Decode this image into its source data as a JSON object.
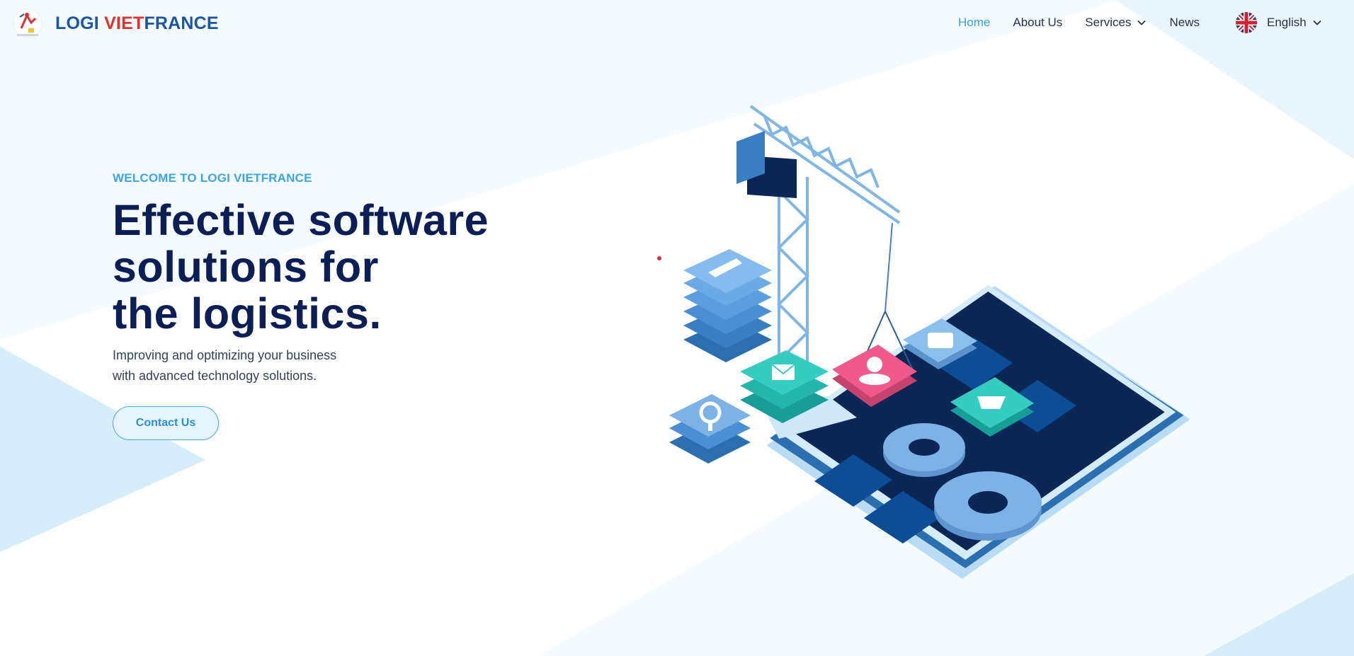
{
  "brand": {
    "name_part1": "LOGI ",
    "name_part2": "VIET",
    "name_part3": "FRANCE",
    "logo_icon": "logi-vietfrance-emblem"
  },
  "nav": {
    "items": [
      {
        "label": "Home",
        "active": true
      },
      {
        "label": "About Us",
        "active": false
      },
      {
        "label": "Services",
        "active": false,
        "has_dropdown": true
      },
      {
        "label": "News",
        "active": false
      }
    ]
  },
  "language": {
    "label": "English",
    "flag_icon": "uk-flag-icon"
  },
  "hero": {
    "eyebrow": "WELCOME TO LOGI VIETFRANCE",
    "title_lines": [
      "Effective software",
      "solutions for",
      "the logistics."
    ],
    "subtitle_lines": [
      "Improving and optimizing your business",
      "with advanced technology solutions."
    ],
    "cta_label": "Contact Us"
  },
  "colors": {
    "accent": "#3a9fe0",
    "title": "#0b1e55",
    "brand_blue": "#1a56a5",
    "brand_red": "#e0312d",
    "background": "#f3fbff"
  }
}
